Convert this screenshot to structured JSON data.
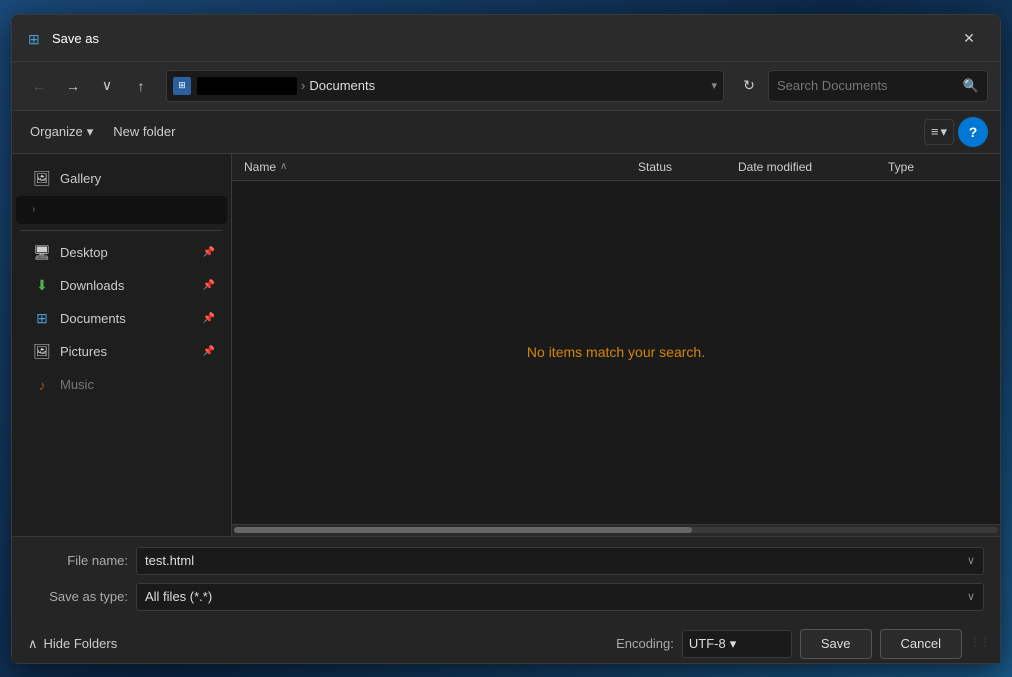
{
  "dialog": {
    "title": "Save as"
  },
  "toolbar": {
    "back_label": "←",
    "forward_label": "→",
    "dropdown_label": "∨",
    "up_label": "↑",
    "refresh_label": "↻",
    "breadcrumb_current": "Documents",
    "breadcrumb_arrow": "›"
  },
  "search": {
    "placeholder": "Search Documents",
    "icon": "🔍"
  },
  "action_bar": {
    "organize_label": "Organize",
    "organize_arrow": "▾",
    "new_folder_label": "New folder",
    "view_icon": "≡",
    "view_arrow": "▾",
    "help_label": "?"
  },
  "columns": {
    "name": "Name",
    "sort_arrow": "∧",
    "status": "Status",
    "date_modified": "Date modified",
    "type": "Type"
  },
  "file_pane": {
    "empty_message": "No items match your search."
  },
  "sidebar": {
    "gallery_label": "Gallery",
    "expand_arrow": "›",
    "quick_access_items": [
      {
        "label": "Desktop",
        "icon": "desktop",
        "pinned": true
      },
      {
        "label": "Downloads",
        "icon": "downloads",
        "pinned": true
      },
      {
        "label": "Documents",
        "icon": "documents",
        "pinned": true
      },
      {
        "label": "Pictures",
        "icon": "pictures",
        "pinned": true
      }
    ]
  },
  "footer": {
    "filename_label": "File name:",
    "filename_value": "test.html",
    "savetype_label": "Save as type:",
    "savetype_value": "All files  (*.*)"
  },
  "footer_bottom": {
    "hide_folders_arrow": "∧",
    "hide_folders_label": "Hide Folders",
    "encoding_label": "Encoding:",
    "encoding_value": "UTF-8",
    "save_label": "Save",
    "cancel_label": "Cancel"
  }
}
